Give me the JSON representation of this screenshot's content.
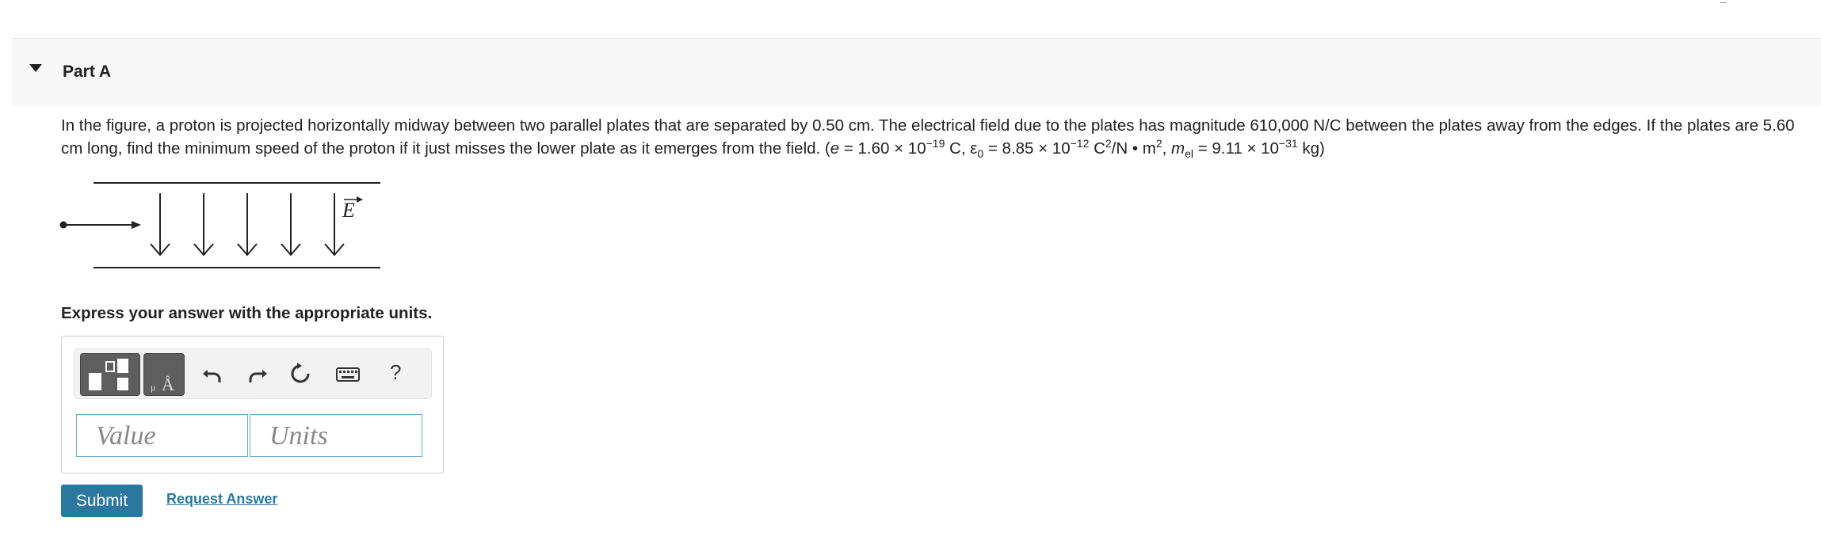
{
  "part": {
    "title": "Part A"
  },
  "problem": {
    "intro": "In the figure, a proton is projected horizontally midway between two parallel plates that are separated by 0.50 cm. The electrical field due to the plates has magnitude 610,000 N/C between the plates away from the edges. If the plates are 5.60 cm long, find the minimum speed of the proton if it just misses the lower plate as it emerges from the field. (",
    "e_symbol": "e",
    "e_eq": " = 1.60 × 10",
    "e_exp": "−19",
    "e_unit": " C, ε",
    "eps_sub": "0",
    "eps_eq": " = 8.85 × 10",
    "eps_exp": "−12",
    "eps_unit": " C",
    "c_exp": "2",
    "nm": "/N • m",
    "m_exp": "2",
    "sep": ", ",
    "m_symbol": "m",
    "m_sub": "el",
    "m_eq": " = 9.11 × 10",
    "m_exp2": "−31",
    "m_unit": " kg)"
  },
  "figure": {
    "field_label": "E"
  },
  "instruction": "Express your answer with the appropriate units.",
  "answer": {
    "value_placeholder": "Value",
    "units_placeholder": "Units",
    "help_label": "?"
  },
  "actions": {
    "submit_label": "Submit",
    "request_label": "Request Answer"
  },
  "icons": [
    "caret-down-icon",
    "template-icon",
    "units-icon",
    "undo-icon",
    "redo-icon",
    "reset-icon",
    "keyboard-icon"
  ]
}
